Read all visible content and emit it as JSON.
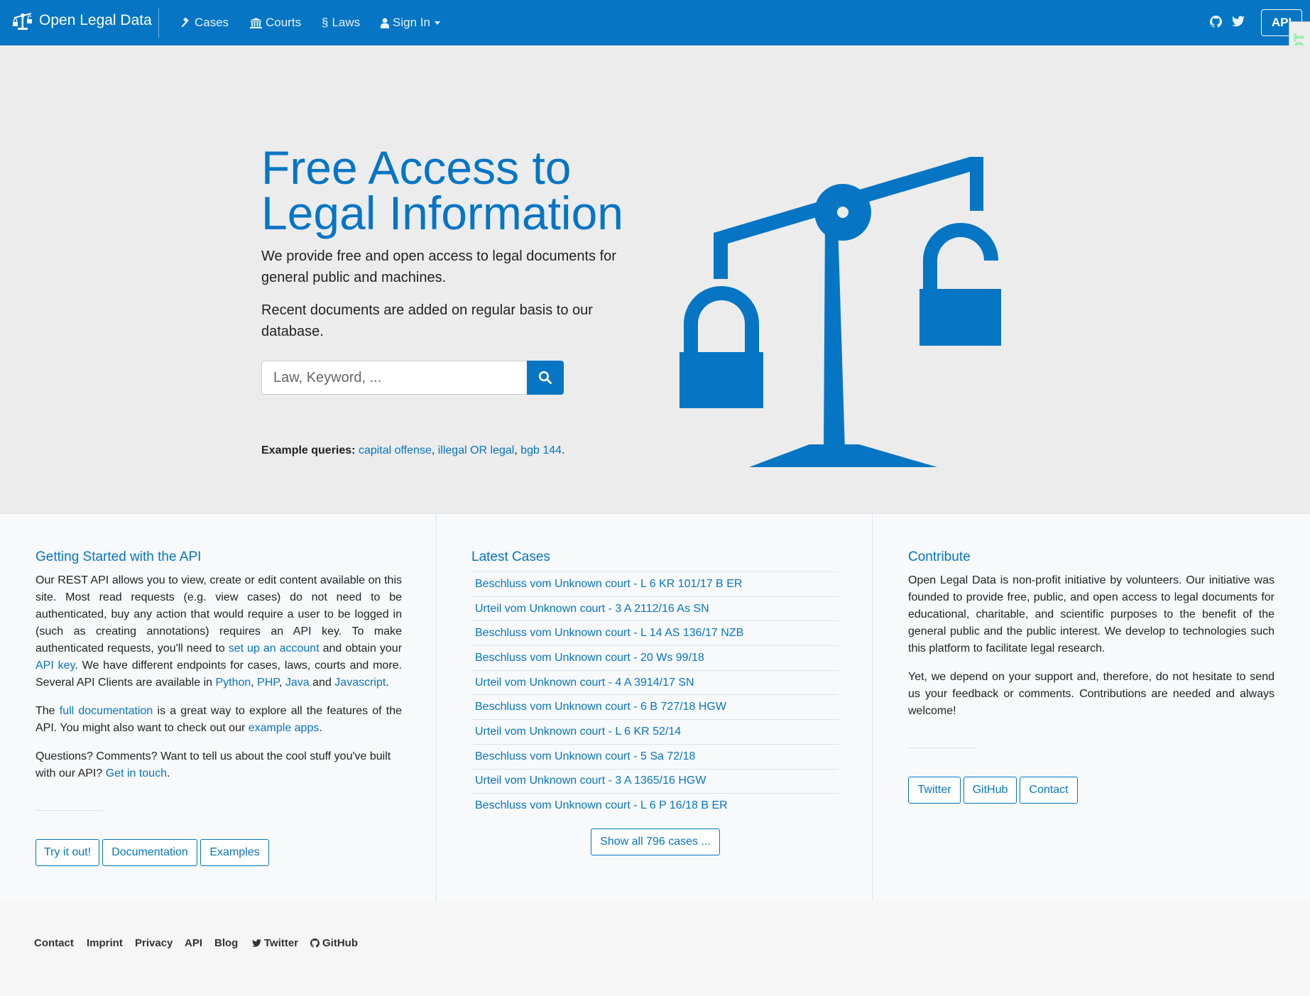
{
  "navbar": {
    "brand": "Open Legal Data",
    "items": [
      {
        "label": "Cases",
        "icon": "gavel-icon"
      },
      {
        "label": "Courts",
        "icon": "institution-icon"
      },
      {
        "label": "Laws",
        "icon": "section-icon",
        "prefix": "§"
      },
      {
        "label": "Sign In",
        "icon": "user-icon"
      }
    ],
    "api_label": "API",
    "ddt_label": "DjDT"
  },
  "hero": {
    "title": "Free Access to Legal Information",
    "paragraph1": "We provide free and open access to legal documents for general public and machines.",
    "paragraph2": "Recent documents are added on regular basis to our database.",
    "search_placeholder": "Law, Keyword, ...",
    "examples_label": "Example queries:",
    "examples": [
      "capital offense",
      "illegal OR legal",
      "bgb 144"
    ]
  },
  "api_section": {
    "title": "Getting Started with the API",
    "p1_a": "Our REST API allows you to view, create or edit content available on this site. Most read requests (e.g. view cases) do not need to be authenticated, buy any action that would require a user to be logged in (such as creating annotations) requires an API key. To make authenticated requests, you'll need to ",
    "p1_link1": "set up an account",
    "p1_b": " and obtain your ",
    "p1_link2": "API key",
    "p1_c": ". We have different endpoints for cases, laws, courts and more. Several API Clients are available in ",
    "clients": [
      "Python",
      "PHP",
      "Java",
      "Javascript"
    ],
    "p2_a": "The ",
    "p2_link1": "full documentation",
    "p2_b": " is a great way to explore all the features of the API. You might also want to check out our ",
    "p2_link2": "example apps",
    "p3_a": "Questions? Comments? Want to tell us about the cool stuff you've built with our API? ",
    "p3_link": "Get in touch",
    "buttons": [
      "Try it out!",
      "Documentation",
      "Examples"
    ]
  },
  "cases_section": {
    "title": "Latest Cases",
    "cases": [
      "Beschluss vom Unknown court - L 6 KR 101/17 B ER",
      "Urteil vom Unknown court - 3 A 2112/16 As SN",
      "Beschluss vom Unknown court - L 14 AS 136/17 NZB",
      "Beschluss vom Unknown court - 20 Ws 99/18",
      "Urteil vom Unknown court - 4 A 3914/17 SN",
      "Beschluss vom Unknown court - 6 B 727/18 HGW",
      "Urteil vom Unknown court - L 6 KR 52/14",
      "Beschluss vom Unknown court - 5 Sa 72/18",
      "Urteil vom Unknown court - 3 A 1365/16 HGW",
      "Beschluss vom Unknown court - L 6 P 16/18 B ER"
    ],
    "show_all": "Show all 796 cases ..."
  },
  "contribute_section": {
    "title": "Contribute",
    "p1": "Open Legal Data is non-profit initiative by volunteers. Our initiative was founded to provide free, public, and open access to legal documents for educational, charitable, and scientific purposes to the benefit of the general public and the public interest. We develop to technologies such this platform to facilitate legal research.",
    "p2": "Yet, we depend on your support and, therefore, do not hesitate to send us your feedback or comments. Contributions are needed and always welcome!",
    "buttons": [
      "Twitter",
      "GitHub",
      "Contact"
    ]
  },
  "footer": {
    "links": [
      "Contact",
      "Imprint",
      "Privacy",
      "API",
      "Blog",
      "Twitter",
      "GitHub"
    ]
  },
  "colors": {
    "primary": "#0575c4",
    "hero_bg": "#ececec",
    "panel_bg": "#f8f9fa"
  }
}
